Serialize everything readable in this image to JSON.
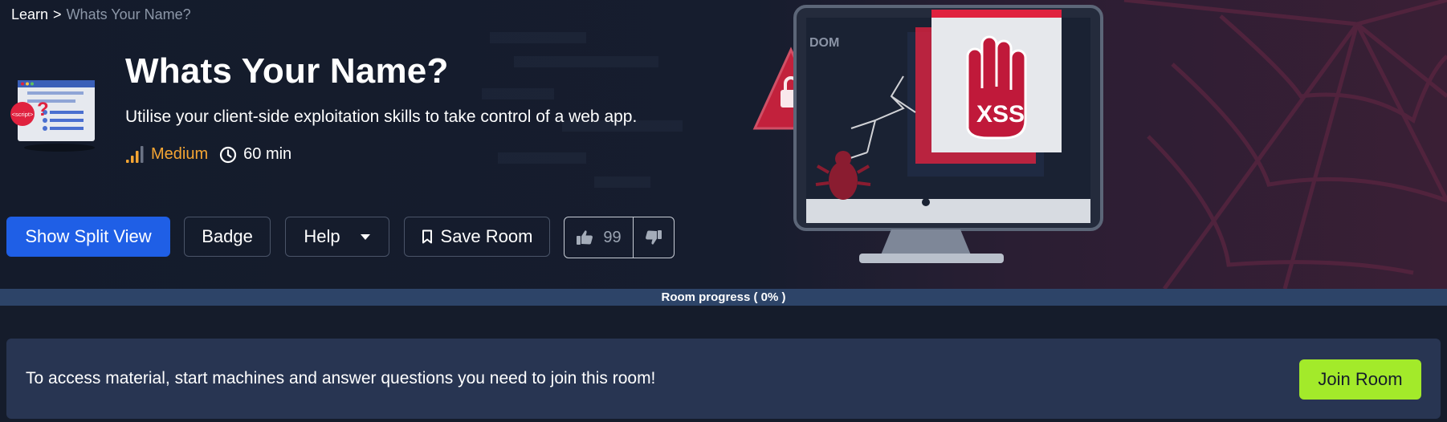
{
  "breadcrumb": {
    "root": "Learn",
    "separator": ">",
    "current": "Whats Your Name?"
  },
  "room": {
    "title": "Whats Your Name?",
    "description": "Utilise your client-side exploitation skills to take control of a web app.",
    "difficulty": "Medium",
    "duration": "60 min",
    "icon_tag": "<script>"
  },
  "hero_art": {
    "dom_label": "DOM",
    "xss_label": "XSS"
  },
  "actions": {
    "split_view": "Show Split View",
    "badge": "Badge",
    "help": "Help",
    "save_room": "Save Room",
    "upvotes": "99"
  },
  "progress": {
    "label": "Room progress ( 0% )",
    "value": 0
  },
  "join": {
    "message": "To access material, start machines and answer questions you need to join this room!",
    "button": "Join Room"
  },
  "colors": {
    "primary_button": "#1f5fe6",
    "join_button": "#a3ea2a",
    "difficulty": "#f5a533",
    "background": "#151c2b"
  },
  "icons": [
    "signal-bars-icon",
    "clock-icon",
    "caret-down-icon",
    "bookmark-icon",
    "thumbs-up-icon",
    "thumbs-down-icon"
  ]
}
